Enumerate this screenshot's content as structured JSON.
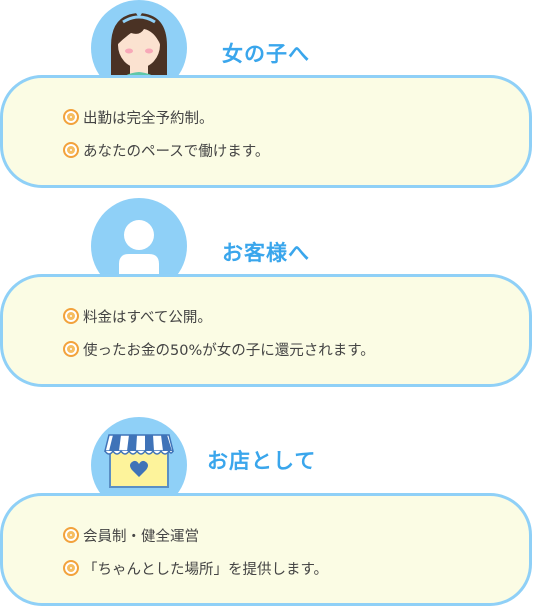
{
  "sections": [
    {
      "id": "girls",
      "icon": "girl-avatar-icon",
      "title": "女の子へ",
      "bullet_marker": "◎",
      "items": [
        "出勤は完全予約制。",
        "あなたのペースで働けます。"
      ]
    },
    {
      "id": "customers",
      "icon": "person-silhouette-icon",
      "title": "お客様へ",
      "bullet_marker": "◎",
      "items": [
        "料金はすべて公開。",
        "使ったお金の50%が女の子に還元されます。"
      ]
    },
    {
      "id": "shop",
      "icon": "shop-awning-heart-icon",
      "title": "お店として",
      "bullet_marker": "◎",
      "items": [
        "会員制・健全運営",
        "「ちゃんとした場所」を提供します。"
      ]
    }
  ],
  "colors": {
    "heading": "#3aa6ec",
    "box_border": "#8fd0f7",
    "box_fill": "#fbfce4",
    "avatar_bg": "#8fd0f7",
    "bullet_marker": "#f2a23c",
    "text": "#444444"
  }
}
